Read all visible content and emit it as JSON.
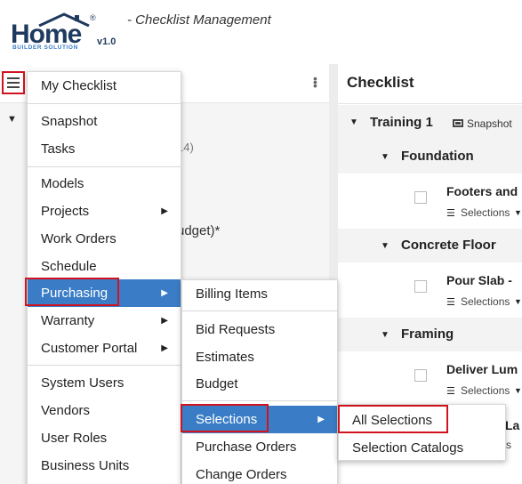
{
  "app": {
    "logo_text": "Home",
    "logo_sub": "BUILDER SOLUTION",
    "version": "v1.0",
    "title": "- Checklist Management"
  },
  "left_panel": {
    "background_text_1": "14)",
    "background_text_2": "udget)*"
  },
  "right_panel": {
    "header": "Checklist",
    "project": {
      "title": "Training 1",
      "tag": "Snapshot"
    },
    "sections": [
      {
        "title": "Foundation",
        "item_title": "Footers and",
        "item_sub": "Selections"
      },
      {
        "title": "Concrete Floor",
        "item_title": "Pour Slab -",
        "item_sub": "Selections"
      },
      {
        "title": "Framing",
        "item_title": "Deliver Lum",
        "item_sub": "Selections"
      }
    ],
    "partial_text_1": "La",
    "partial_text_2": "s"
  },
  "main_menu": {
    "items": [
      "My Checklist",
      "Snapshot",
      "Tasks",
      "Models",
      "Projects",
      "Work Orders",
      "Schedule",
      "Purchasing",
      "Warranty",
      "Customer Portal",
      "System Users",
      "Vendors",
      "User Roles",
      "Business Units"
    ]
  },
  "purchasing_menu": {
    "items": [
      "Billing Items",
      "Bid Requests",
      "Estimates",
      "Budget",
      "Selections",
      "Purchase Orders",
      "Change Orders"
    ]
  },
  "selections_menu": {
    "items": [
      "All Selections",
      "Selection Catalogs"
    ]
  },
  "colors": {
    "accent": "#3a7dc6",
    "highlight": "#d0141f",
    "brand": "#1f3a5f"
  },
  "icons": {
    "menu": "hamburger-icon",
    "more": "kebab-icon",
    "submenu": "triangle-right-icon",
    "expand": "triangle-down-icon",
    "snapshot": "snapshot-icon",
    "list": "list-icon"
  }
}
